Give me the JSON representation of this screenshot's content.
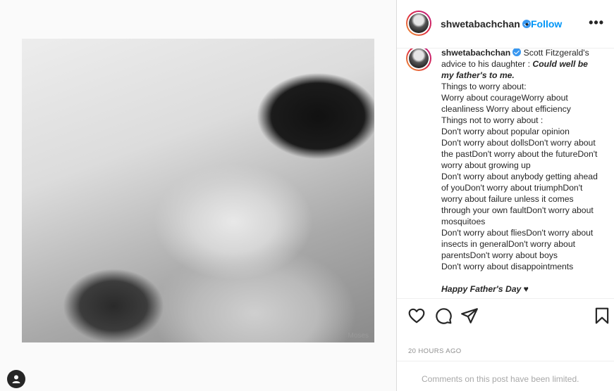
{
  "photo": {
    "watermark": "Moses"
  },
  "post": {
    "username": "shwetabachchan",
    "separator": "•",
    "follow_label": "Follow",
    "more_label": "•••",
    "caption_intro": "Scott Fitzgerald's advice to his daughter : ",
    "caption_quote": "Could well be my father's to me.",
    "caption_lines": [
      "Things to worry about:",
      "Worry about courageWorry about cleanliness Worry about efficiency",
      "Things not to worry about :",
      "Don't worry about popular opinion",
      "Don't worry about dollsDon't worry about the pastDon't worry about the futureDon't worry about growing up",
      "Don't worry about anybody getting ahead of youDon't worry about triumphDon't worry about failure unless it comes through your own faultDon't worry about mosquitoes",
      "Don't worry about fliesDon't worry about insects in generalDon't worry about parentsDon't worry about boys",
      "Don't worry about disappointments"
    ],
    "closing": "Happy Father's Day ♥",
    "timestamp": "20 HOURS AGO",
    "comments_limited": "Comments on this post have been limited."
  },
  "icons": {
    "like": "heart-icon",
    "comment": "comment-icon",
    "share": "send-icon",
    "save": "bookmark-icon",
    "verified": "verified-badge-icon",
    "user": "user-avatar-icon"
  },
  "colors": {
    "follow": "#0095f6",
    "verified": "#3897f0",
    "muted": "#8e8e8e"
  }
}
